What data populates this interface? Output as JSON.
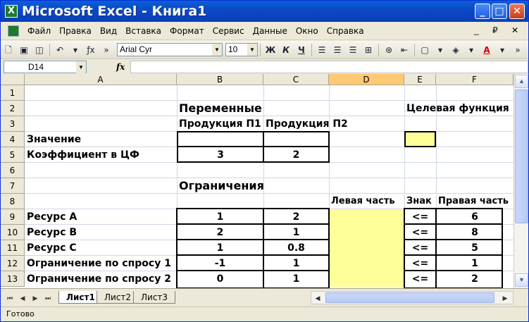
{
  "window": {
    "title": "Microsoft Excel - Книга1",
    "app_icon_glyph": "X",
    "minimize_glyph": "_",
    "maximize_glyph": "□",
    "close_glyph": "✕"
  },
  "menu": {
    "items": [
      "Файл",
      "Правка",
      "Вид",
      "Вставка",
      "Формат",
      "Сервис",
      "Данные",
      "Окно",
      "Справка"
    ],
    "right_controls": "_ ₽ ✕"
  },
  "toolbar": {
    "font_name": "Arial Cyr",
    "font_size": "10",
    "bold_label": "Ж",
    "italic_label": "К",
    "underline_label": "Ч",
    "fx_label": "ƒx",
    "more_label": "»"
  },
  "formula_bar": {
    "name_box": "D14",
    "fx_label": "fx",
    "formula": ""
  },
  "grid": {
    "columns": [
      "A",
      "B",
      "C",
      "D",
      "E",
      "F"
    ],
    "selected_column": "D",
    "rows": [
      "1",
      "2",
      "3",
      "4",
      "5",
      "6",
      "7",
      "8",
      "9",
      "10",
      "11",
      "12",
      "13"
    ],
    "section_variables": "Переменные",
    "objective_function": "Целевая функция",
    "product_p1": "Продукция П1",
    "product_p2": "Продукция П2",
    "value_label": "Значение",
    "coef_label": "Коэффициент в ЦФ",
    "coef_p1": "3",
    "coef_p2": "2",
    "section_constraints": "Ограничения",
    "lhs_header": "Левая часть",
    "sign_header": "Знак",
    "rhs_header": "Правая часть",
    "constraints": [
      {
        "name": "Ресурс А",
        "p1": "1",
        "p2": "2",
        "sign": "<=",
        "rhs": "6"
      },
      {
        "name": "Ресурс В",
        "p1": "2",
        "p2": "1",
        "sign": "<=",
        "rhs": "8"
      },
      {
        "name": "Ресурс С",
        "p1": "1",
        "p2": "0.8",
        "sign": "<=",
        "rhs": "5"
      },
      {
        "name": "Ограничение по спросу 1",
        "p1": "-1",
        "p2": "1",
        "sign": "<=",
        "rhs": "1"
      },
      {
        "name": "Ограничение по спросу 2",
        "p1": "0",
        "p2": "1",
        "sign": "<=",
        "rhs": "2"
      }
    ]
  },
  "sheets": {
    "tabs": [
      "Лист1",
      "Лист2",
      "Лист3"
    ],
    "active": "Лист1"
  },
  "status": {
    "text": "Готово"
  },
  "colors": {
    "title_bar": "#0b49c4",
    "highlight_cell": "#ffff99",
    "selected_header": "#ffc873"
  }
}
